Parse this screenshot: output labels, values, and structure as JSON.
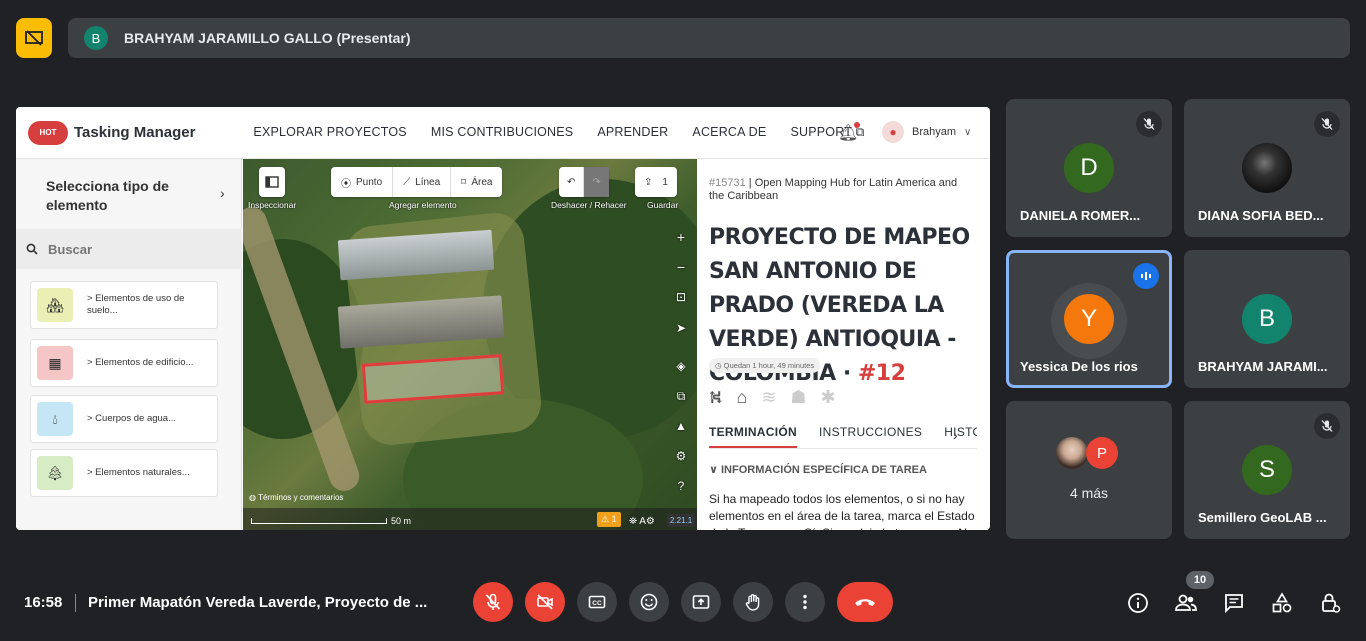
{
  "top": {
    "presenter_initial": "B",
    "presenter_label": "BRAHYAM JARAMILLO GALLO (Presentar)"
  },
  "screen": {
    "logo_badge": "HOT",
    "logo_text": "Tasking Manager",
    "nav": [
      "EXPLORAR PROYECTOS",
      "MIS CONTRIBUCIONES",
      "APRENDER",
      "ACERCA DE",
      "SUPPORT ⧉"
    ],
    "user_name": "Brahyam",
    "left_panel": {
      "title": "Selecciona tipo de elemento",
      "search_placeholder": "Buscar",
      "items": [
        {
          "label": "> Elementos de uso de suelo...",
          "color": "#eaf0b4"
        },
        {
          "label": "> Elementos de edificio...",
          "color": "#f5c6c6"
        },
        {
          "label": "> Cuerpos de agua...",
          "color": "#c4e6f5"
        },
        {
          "label": "> Elementos naturales...",
          "color": "#d6ecc4"
        }
      ]
    },
    "map": {
      "inspector_caption": "Inspeccionar",
      "tools": [
        "Punto",
        "Línea",
        "Área"
      ],
      "add_caption": "Agregar elemento",
      "undo_caption": "Deshacer / Rehacer",
      "save_count": "1",
      "save_caption": "Guardar",
      "terms": "Términos y comentarios",
      "scale": "50 m",
      "warnings": "⚠ 1",
      "issues": "⛯ A⚙",
      "version": "2.21.1"
    },
    "right_panel": {
      "project_id": "#15731",
      "org": "| Open Mapping Hub for Latin America and the Caribbean",
      "title": "PROYECTO DE MAPEO SAN ANTONIO DE PRADO (VEREDA LA VERDE) ANTIOQUIA - COLOMBIA ·",
      "task": "#12",
      "time_left": "Quedan 1 hour, 49 minutes",
      "tabs": [
        "TERMINACIÓN",
        "INSTRUCCIONES",
        "HISTORIA"
      ],
      "section": "∨ INFORMACIÓN ESPECÍFICA DE TAREA",
      "text": "Si ha mapeado todos los elementos, o si no hay elementos en el área de la tarea, marca el Estado de la Tarea como Sí. Si no, deja la tarea como No."
    }
  },
  "participants": [
    {
      "name": "DANIELA ROMER...",
      "initial": "D",
      "color": "#33691e",
      "muted": true
    },
    {
      "name": "DIANA SOFIA BED...",
      "initial": "",
      "color": "#111111",
      "muted": true
    },
    {
      "name": "Yessica De los rios",
      "initial": "Y",
      "color": "#f4780b",
      "muted": false
    },
    {
      "name": "BRAHYAM JARAMI...",
      "initial": "B",
      "color": "#12846e",
      "muted": false
    },
    {
      "name": "4 más",
      "initial": "P",
      "color": "#ea4335",
      "muted": false
    },
    {
      "name": "Semillero GeoLAB ...",
      "initial": "S",
      "color": "#33691e",
      "muted": true
    }
  ],
  "bottom": {
    "time": "16:58",
    "meeting": "Primer Mapatón Vereda Laverde, Proyecto de ...",
    "people_count": "10"
  }
}
